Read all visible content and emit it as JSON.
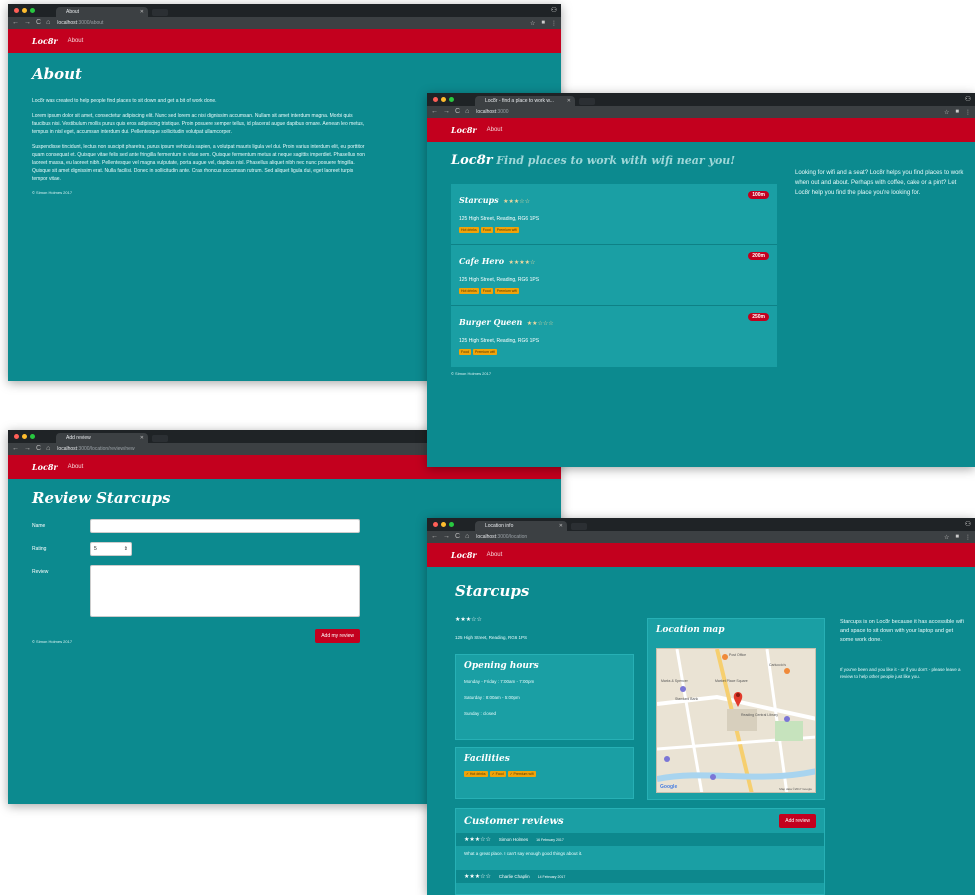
{
  "common": {
    "brand": "Loc8r",
    "nav_about": "About",
    "footer": "© Simon Holmes 2017",
    "url_host": "localhost"
  },
  "about_window": {
    "tab_title": "About",
    "url_path": ":3000/about",
    "heading": "About",
    "paragraphs": [
      "Loc8r was created to help people find places to sit down and get a bit of work done.",
      "Lorem ipsum dolor sit amet, consectetur adipiscing elit. Nunc sed lorem ac nisi dignissim accumsan. Nullam sit amet interdum magna. Morbi quis faucibus nisi. Vestibulum mollis purus quis eros adipiscing tristique. Proin posuere semper tellus, id placerat augue dapibus ornare. Aenean leo metus, tempus in nisl eget, accumsan interdum dui. Pellentesque sollicitudin volutpat ullamcorper.",
      "Suspendisse tincidunt, lectus non suscipit pharetra, purus ipsum vehicula sapien, a volutpat mauris ligula vel dui. Proin varius interdum elit, eu porttitor quam consequat et. Quisque vitae felis sed ante fringilla fermentum in vitae sem. Quisque fermentum metus at neque sagittis imperdiet. Phasellus non laoreet massa, eu laoreet nibh. Pellentesque vel magna vulputate, porta augue vel, dapibus nisl. Phasellus aliquet nibh nec nunc posuere fringilla. Quisque sit amet dignissim erat. Nulla facilisi. Donec in sollicitudin ante. Cras rhoncus accumsan rutrum. Sed aliquet ligula dui, eget laoreet turpis tempor vitae."
    ]
  },
  "home_window": {
    "tab_title": "Loc8r - find a place to work w...",
    "url_path": ":3000",
    "heading_brand": "Loc8r",
    "heading_tagline": "Find places to work with wifi near you!",
    "sidebar": "Looking for wifi and a seat? Loc8r helps you find places to work when out and about. Perhaps with coffee, cake or a pint? Let Loc8r help you find the place you're looking for.",
    "locations": [
      {
        "name": "Starcups",
        "stars": "★★★☆☆",
        "distance": "100m",
        "address": "125 High Street, Reading, RG6 1PS",
        "tags": [
          "Hot drinks",
          "Food",
          "Premium wifi"
        ]
      },
      {
        "name": "Cafe Hero",
        "stars": "★★★★☆",
        "distance": "200m",
        "address": "125 High Street, Reading, RG6 1PS",
        "tags": [
          "Hot drinks",
          "Food",
          "Premium wifi"
        ]
      },
      {
        "name": "Burger Queen",
        "stars": "★★☆☆☆",
        "distance": "250m",
        "address": "125 High Street, Reading, RG6 1PS",
        "tags": [
          "Food",
          "Premium wifi"
        ]
      }
    ]
  },
  "review_window": {
    "tab_title": "Add review",
    "url_path": ":3000/location/review/new",
    "heading": "Review Starcups",
    "label_name": "Name",
    "label_rating": "Rating",
    "rating_value": "5",
    "label_review": "Review",
    "submit": "Add my review"
  },
  "detail_window": {
    "tab_title": "Location info",
    "url_path": ":3000/location",
    "heading": "Starcups",
    "stars": "★★★☆☆",
    "address": "125 High Street, Reading, RG6 1PS",
    "opening_title": "Opening hours",
    "hours": [
      "Monday - Friday : 7:00am - 7:00pm",
      "Saturday : 8:00am - 5:00pm",
      "Sunday : closed"
    ],
    "facilities_title": "Facilities",
    "facilities": [
      "✓ Hot drinks",
      "✓ Food",
      "✓ Premium wifi"
    ],
    "map_title": "Location map",
    "map_labels": [
      "Post Office",
      "Marks & Spencer",
      "Standard Bank",
      "Market Place Square",
      "Reading Central Library",
      "Carluccio's",
      "Google",
      "Map data ©2017 Google"
    ],
    "sidebar_main": "Starcups is on Loc8r because it has accessible wifi and space to sit down with your laptop and get some work done.",
    "sidebar_sub": "If you've been and you like it - or if you don't - please leave a review to help other people just like you.",
    "reviews_title": "Customer reviews",
    "add_review": "Add review",
    "reviews": [
      {
        "stars": "★★★☆☆",
        "author": "Simon Holmes",
        "date": "16 February 2017",
        "text": "What a great place. I can't say enough good things about it."
      },
      {
        "stars": "★★★☆☆",
        "author": "Charlie Chaplin",
        "date": "14 February 2017",
        "text": ""
      }
    ]
  },
  "colors": {
    "teal": "#0c8a8f",
    "red": "#c3001e",
    "panel": "#1a9fa4",
    "tag": "#f0a30a"
  }
}
